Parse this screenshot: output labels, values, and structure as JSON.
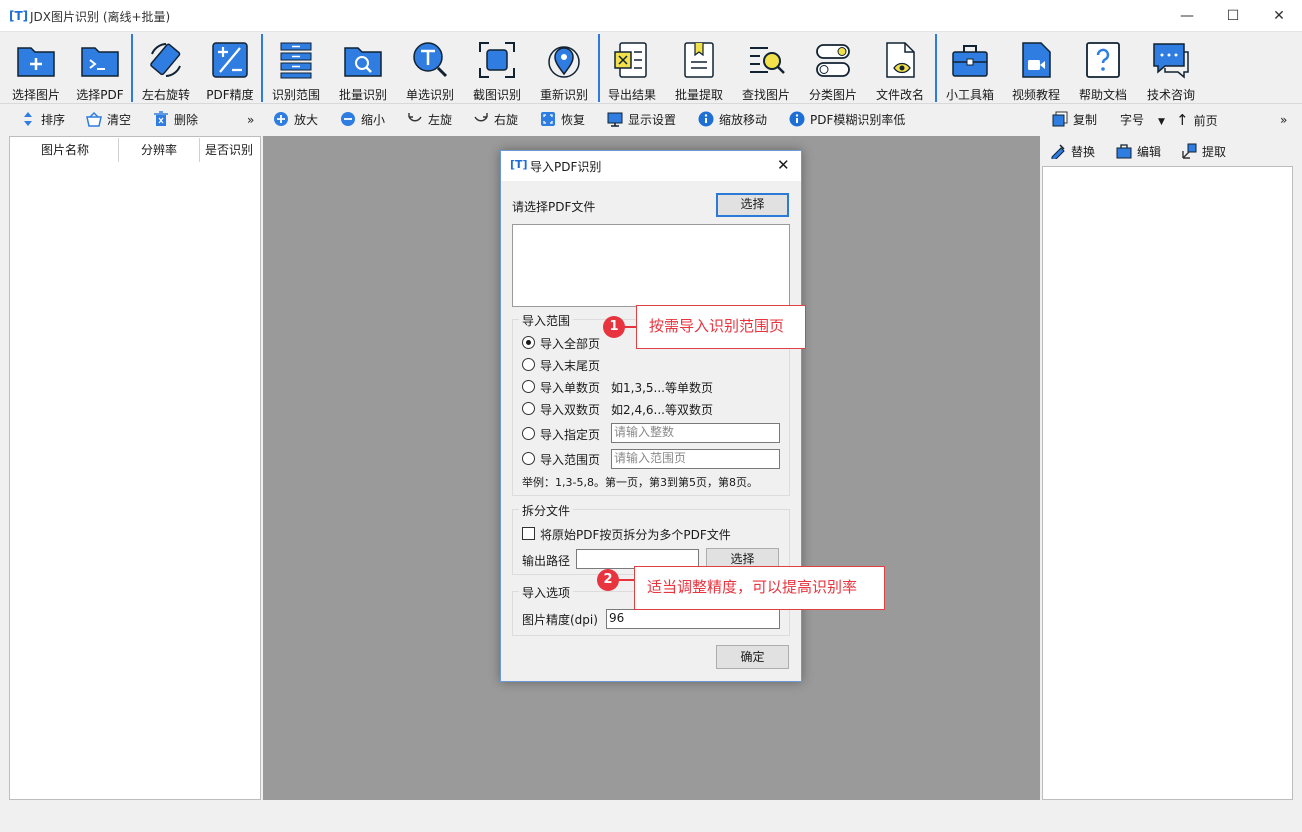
{
  "window": {
    "title": "JDX图片识别 (离线+批量)",
    "logo": "[T]",
    "minimize": "—",
    "maximize": "☐",
    "close": "✕"
  },
  "toolbar": {
    "buttons": [
      {
        "label": "选择图片",
        "icon": "folder-add-icon"
      },
      {
        "label": "选择PDF",
        "icon": "terminal-folder-icon"
      },
      {
        "label": "左右旋转",
        "icon": "rotate-icon"
      },
      {
        "label": "PDF精度",
        "icon": "plus-minus-icon"
      },
      {
        "label": "识别范围",
        "icon": "list-range-icon"
      },
      {
        "label": "批量识别",
        "icon": "folder-search-icon"
      },
      {
        "label": "单选识别",
        "icon": "text-search-icon"
      },
      {
        "label": "截图识别",
        "icon": "screenshot-icon"
      },
      {
        "label": "重新识别",
        "icon": "target-icon"
      },
      {
        "label": "导出结果",
        "icon": "export-icon"
      },
      {
        "label": "批量提取",
        "icon": "bookmark-doc-icon"
      },
      {
        "label": "查找图片",
        "icon": "find-image-icon"
      },
      {
        "label": "分类图片",
        "icon": "toggle-icon"
      },
      {
        "label": "文件改名",
        "icon": "file-eye-icon"
      },
      {
        "label": "小工具箱",
        "icon": "toolbox-icon"
      },
      {
        "label": "视频教程",
        "icon": "video-icon"
      },
      {
        "label": "帮助文档",
        "icon": "help-icon"
      },
      {
        "label": "技术咨询",
        "icon": "chat-icon"
      }
    ]
  },
  "subtoolbar": {
    "left": {
      "sort": "排序",
      "clear": "清空",
      "delete": "删除",
      "more": "»"
    },
    "middle": {
      "zoom_in": "放大",
      "zoom_out": "缩小",
      "rotate_left": "左旋",
      "rotate_right": "右旋",
      "restore": "恢复",
      "display": "显示设置",
      "zoom_move": "缩放移动",
      "pdf_blur": "PDF模糊识别率低"
    },
    "right": {
      "copy": "复制",
      "font": "字号",
      "prev": "前页",
      "more": "»",
      "replace": "替换",
      "edit": "编辑",
      "extract": "提取"
    }
  },
  "file_list": {
    "columns": [
      "图片名称",
      "分辨率",
      "是否识别"
    ]
  },
  "dialog": {
    "title": "导入PDF识别",
    "select_prompt": "请选择PDF文件",
    "select_button": "选择",
    "range_group": "导入范围",
    "options": [
      {
        "label": "导入全部页",
        "note": "",
        "checked": true
      },
      {
        "label": "导入末尾页",
        "note": "",
        "checked": false
      },
      {
        "label": "导入单数页",
        "note": "如1,3,5...等单数页",
        "checked": false
      },
      {
        "label": "导入双数页",
        "note": "如2,4,6...等双数页",
        "checked": false
      },
      {
        "label": "导入指定页",
        "placeholder": "请输入整数",
        "checked": false
      },
      {
        "label": "导入范围页",
        "placeholder": "请输入范围页",
        "checked": false
      }
    ],
    "example": "举例：1,3-5,8。第一页，第3到第5页，第8页。",
    "split_group": "拆分文件",
    "split_checkbox": "将原始PDF按页拆分为多个PDF文件",
    "output_label": "输出路径",
    "output_value": "",
    "output_button": "选择",
    "import_group": "导入选项",
    "dpi_label": "图片精度(dpi)",
    "dpi_value": "96",
    "ok_button": "确定"
  },
  "annotations": [
    {
      "number": "1",
      "text": "按需导入识别范围页"
    },
    {
      "number": "2",
      "text": "适当调整精度，可以提高识别率"
    }
  ],
  "colors": {
    "accent": "#1d6fd6",
    "icon_blue": "#2f7de1",
    "callout_red": "#e8343f",
    "canvas": "#9a9a9a"
  }
}
